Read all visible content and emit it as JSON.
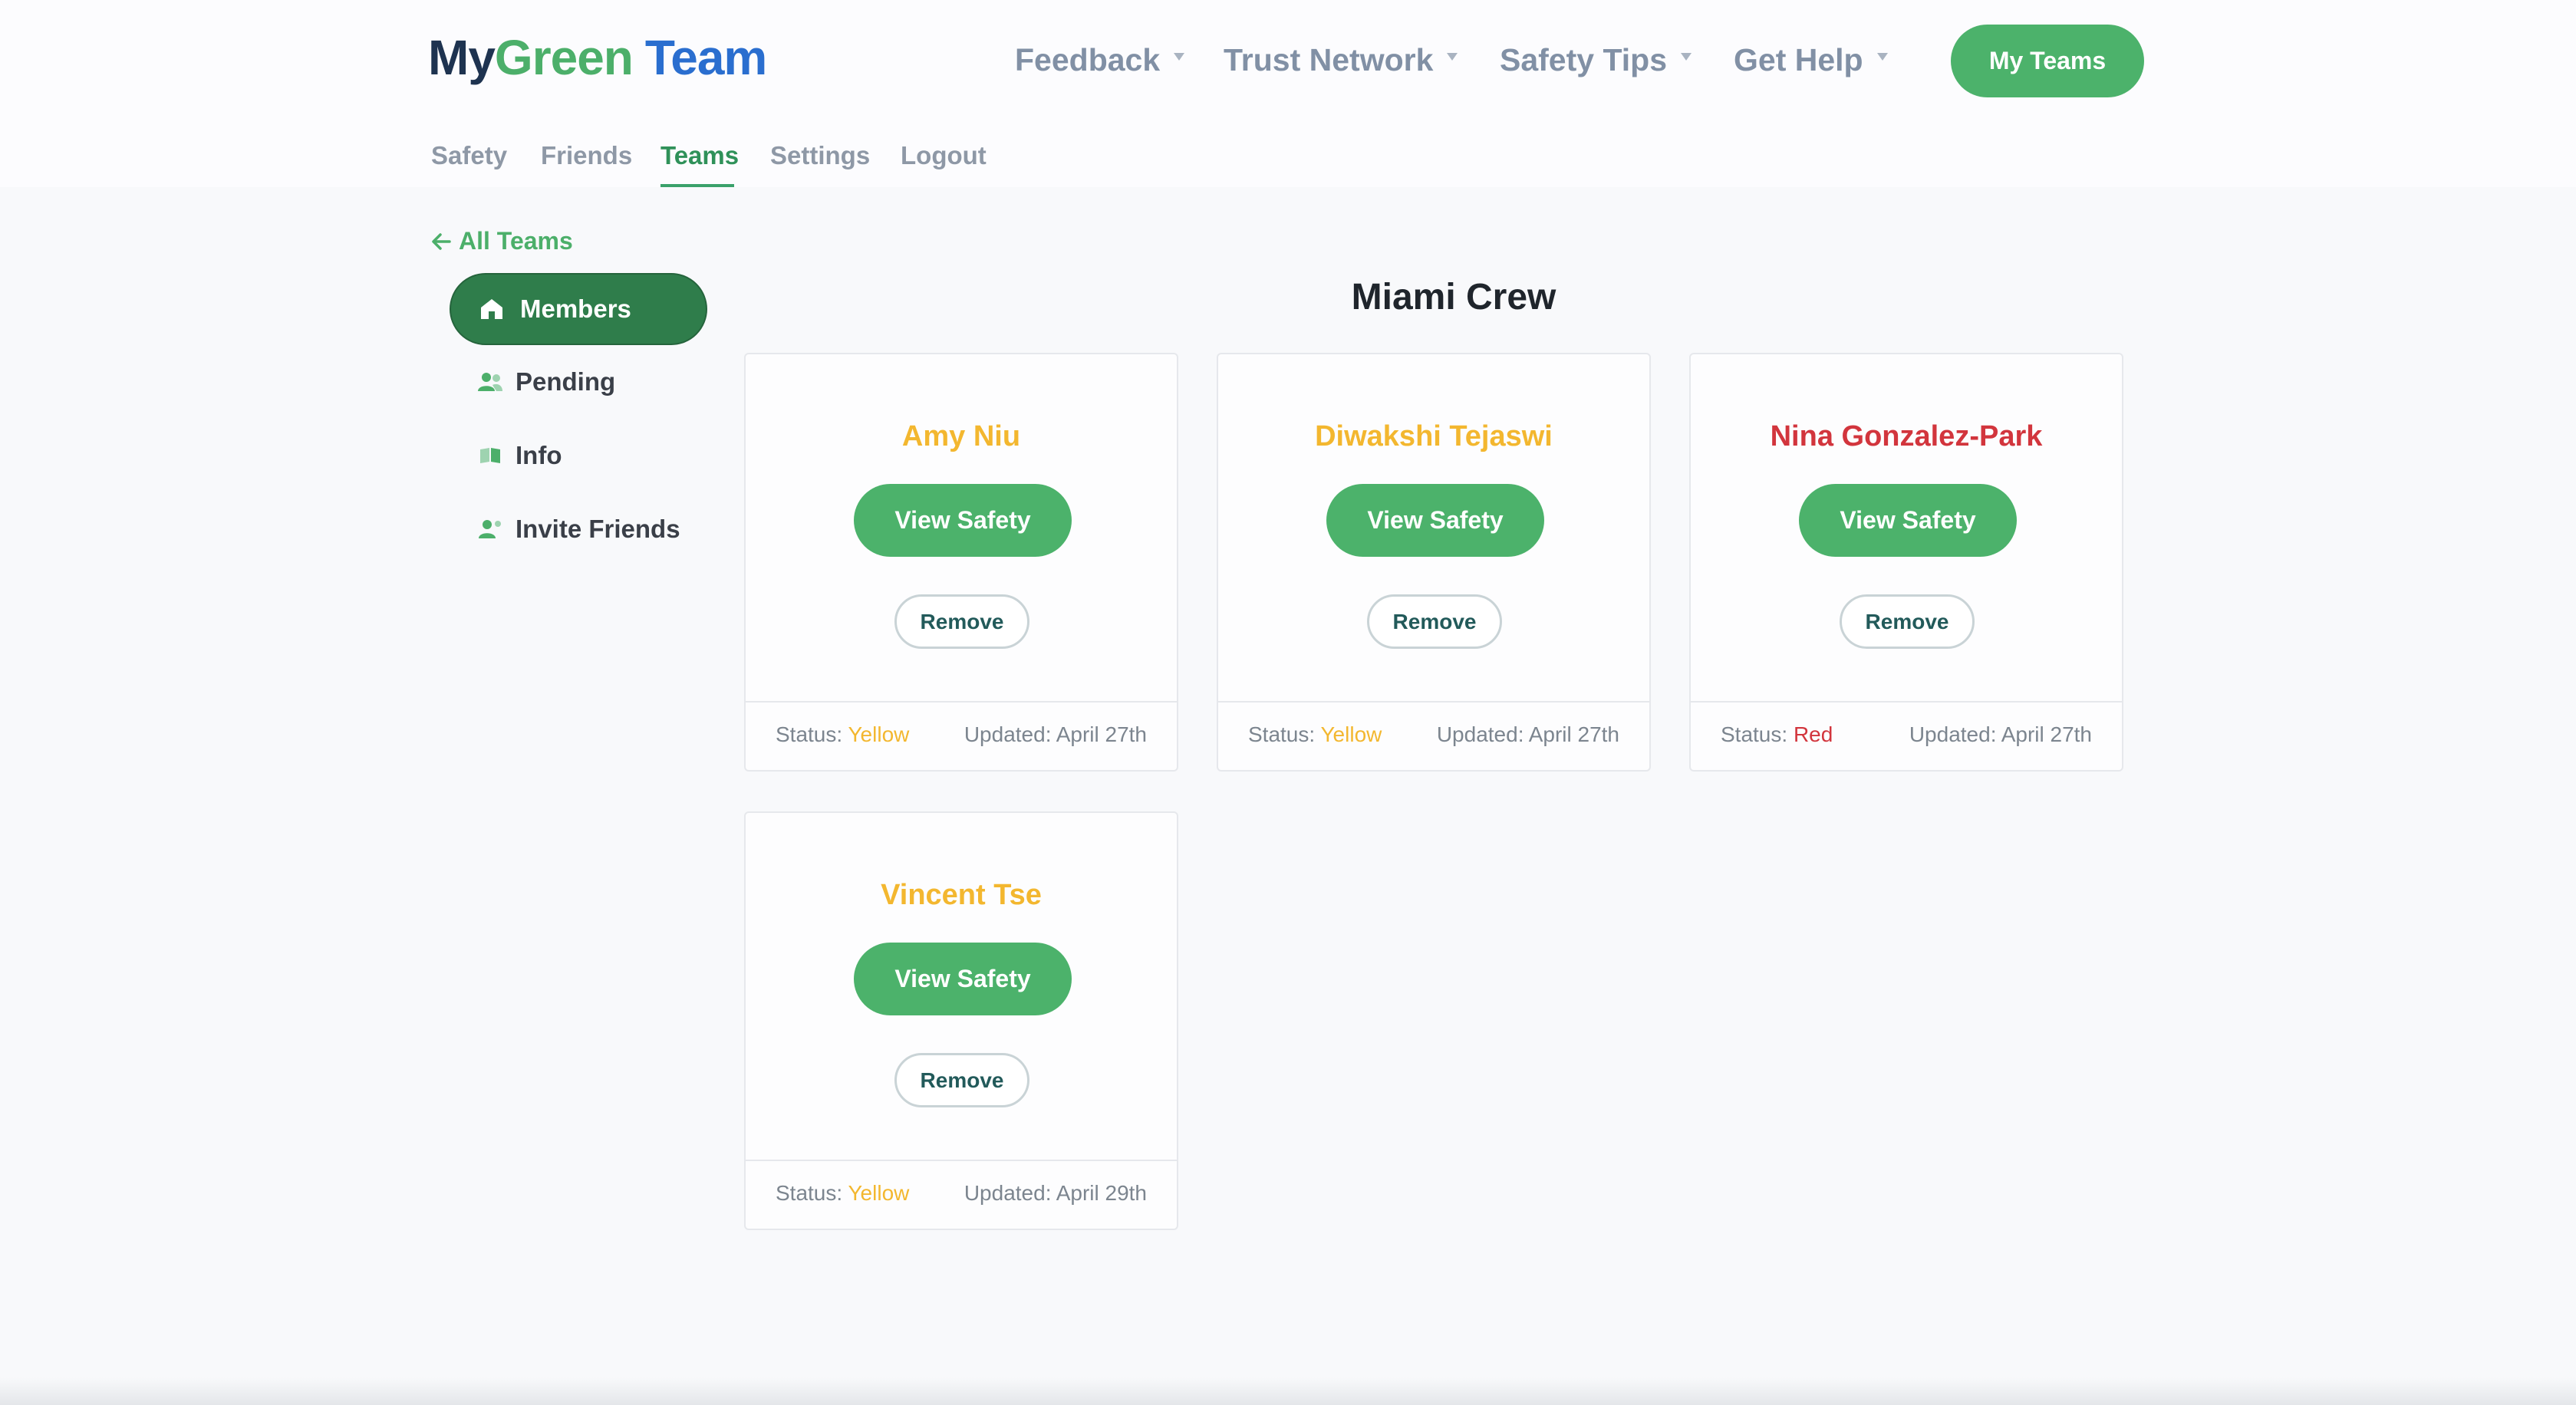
{
  "app": {
    "logo": {
      "part1": "My",
      "part2": "Green",
      "part3": "Team"
    }
  },
  "main_nav": [
    {
      "label": "Feedback"
    },
    {
      "label": "Trust Network"
    },
    {
      "label": "Safety Tips"
    },
    {
      "label": "Get Help"
    }
  ],
  "my_teams_button": "My Teams",
  "sub_nav": [
    {
      "label": "Safety"
    },
    {
      "label": "Friends"
    },
    {
      "label": "Teams",
      "active": true
    },
    {
      "label": "Settings"
    },
    {
      "label": "Logout"
    }
  ],
  "sidebar": {
    "back_label": "All Teams",
    "items": [
      {
        "label": "Members",
        "icon": "home-icon",
        "active": true
      },
      {
        "label": "Pending",
        "icon": "people-icon"
      },
      {
        "label": "Info",
        "icon": "book-icon"
      },
      {
        "label": "Invite Friends",
        "icon": "add-person-icon"
      }
    ]
  },
  "team": {
    "title": "Miami Crew",
    "members": [
      {
        "name": "Amy Niu",
        "view_label": "View Safety",
        "remove_label": "Remove",
        "status_label": "Status:",
        "status": "Yellow",
        "updated": "Updated: April 27th"
      },
      {
        "name": "Diwakshi Tejaswi",
        "view_label": "View Safety",
        "remove_label": "Remove",
        "status_label": "Status:",
        "status": "Yellow",
        "updated": "Updated: April 27th"
      },
      {
        "name": "Nina Gonzalez-Park",
        "view_label": "View Safety",
        "remove_label": "Remove",
        "status_label": "Status:",
        "status": "Red",
        "updated": "Updated: April 27th"
      },
      {
        "name": "Vincent Tse",
        "view_label": "View Safety",
        "remove_label": "Remove",
        "status_label": "Status:",
        "status": "Yellow",
        "updated": "Updated: April 29th"
      }
    ]
  },
  "colors": {
    "accent_green": "#4cb26b",
    "dark_green": "#2f7d4b",
    "status_yellow": "#f3b72f",
    "status_red": "#d2353d"
  }
}
